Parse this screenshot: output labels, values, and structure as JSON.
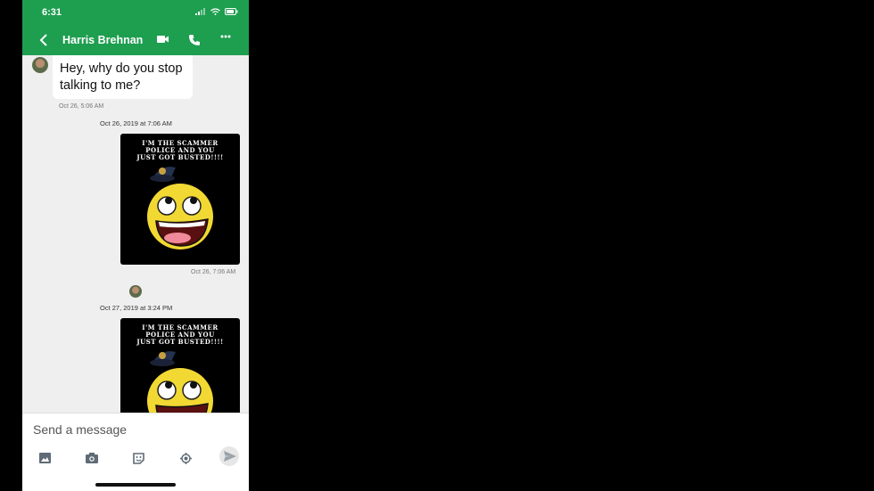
{
  "status": {
    "time": "6:31"
  },
  "header": {
    "contact_name": "Harris Brehnan"
  },
  "messages": {
    "incoming_text": "Hey, why do you stop talking to me?",
    "incoming_time": "Oct 26, 5:06 AM",
    "date1": "Oct 26, 2019 at 7:06 AM",
    "meme_text_line1": "I'M THE SCAMMER",
    "meme_text_line2": "POLICE AND YOU",
    "meme_text_line3": "JUST GOT BUSTED!!!!",
    "outgoing_time1": "Oct 26, 7:06 AM",
    "date2": "Oct 27, 2019 at 3:24 PM"
  },
  "composer": {
    "placeholder": "Send a message"
  },
  "colors": {
    "brand": "#1e9e4f"
  },
  "icons": [
    "back-arrow-icon",
    "video-call-icon",
    "phone-icon",
    "more-icon",
    "gallery-icon",
    "camera-icon",
    "sticker-icon",
    "location-icon",
    "send-icon"
  ]
}
